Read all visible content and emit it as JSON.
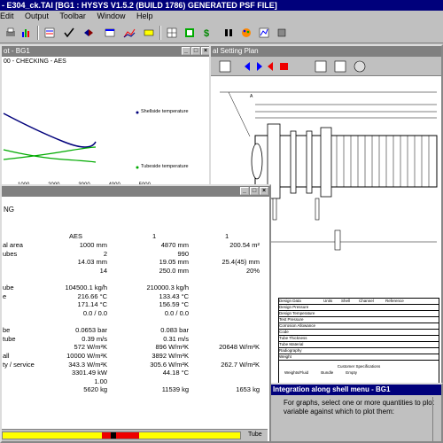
{
  "app": {
    "title": "- E304_ck.TAI [BG1 : HYSYS V1.5.2 (BUILD 1786) GENERATED PSF FILE]",
    "menu": [
      "Edit",
      "Output",
      "Toolbar",
      "Window",
      "Help"
    ],
    "toolbar_icons": [
      "print-icon",
      "bar-chart-icon",
      "data-icon",
      "checkmark-icon",
      "arrows-icon",
      "window-icon",
      "chart-icon",
      "drawing-icon",
      "grid-icon",
      "table-icon",
      "dollar-icon",
      "pause-icon",
      "palette-icon",
      "plot-icon",
      "box-icon"
    ]
  },
  "plot_window": {
    "title": "ot - BG1",
    "subtitle": "00 - CHECKING - AES",
    "legend": [
      "Shellside temperature",
      "Tubeside temperature"
    ],
    "x_ticks": [
      "1000",
      "2000",
      "3000",
      "4000",
      "5000"
    ]
  },
  "setting_plan": {
    "title": "al Setting Plan",
    "dim_label": "A",
    "spec_block": {
      "header": [
        "Design Data",
        "Units",
        "Shell",
        "Channel",
        "Reference"
      ],
      "rows": [
        "Design Pressure",
        "Design Temperature",
        "Test Pressure",
        "Corrosion Allowance",
        "Code",
        "Tube Thickness",
        "Tube Material",
        "Radiography",
        "Weight"
      ]
    },
    "notes": [
      "Customer Specifications",
      "Weights/Fluid",
      "Bundle",
      "Empty"
    ]
  },
  "results_window": {
    "title": "NG",
    "col_headers": [
      "AES",
      "1",
      "1"
    ],
    "rows": [
      {
        "label": "al area",
        "c1": "1000 mm",
        "c2": "4870 mm",
        "c3": "200.54 m²"
      },
      {
        "label": "ubes",
        "c1": "2",
        "c2": "990",
        "c3": ""
      },
      {
        "label": "",
        "c1": "14.03 mm",
        "c2": "19.05 mm",
        "c3": "25.4(45) mm"
      },
      {
        "label": "",
        "c1": "14",
        "c2": "250.0 mm",
        "c3": "20%"
      },
      {
        "label": "",
        "c1": "",
        "c2": "",
        "c3": ""
      },
      {
        "label": "ube",
        "c1": "104500.1 kg/h",
        "c2": "210000.3 kg/h",
        "c3": ""
      },
      {
        "label": "e",
        "c1": "216.66 °C",
        "c2": "133.43 °C",
        "c3": ""
      },
      {
        "label": "",
        "c1": "171.14 °C",
        "c2": "156.59 °C",
        "c3": ""
      },
      {
        "label": "",
        "c1": "0.0 / 0.0",
        "c2": "0.0 / 0.0",
        "c3": ""
      },
      {
        "label": "",
        "c1": "",
        "c2": "",
        "c3": ""
      },
      {
        "label": "be",
        "c1": "0.0653 bar",
        "c2": "0.083 bar",
        "c3": ""
      },
      {
        "label": "tube",
        "c1": "0.39 m/s",
        "c2": "0.31 m/s",
        "c3": ""
      },
      {
        "label": "",
        "c1": "572 W/m²K",
        "c2": "896 W/m²K",
        "c3": "20648 W/m²K"
      },
      {
        "label": "all",
        "c1": "10000 W/m²K",
        "c2": "3892 W/m²K",
        "c3": ""
      },
      {
        "label": "ty / service",
        "c1": "343.3 W/m²K",
        "c2": "305.6 W/m²K",
        "c3": "262.7 W/m²K"
      },
      {
        "label": "",
        "c1": "3301.49 kW",
        "c2": "44.18 °C",
        "c3": ""
      },
      {
        "label": "",
        "c1": "1.00",
        "c2": "",
        "c3": ""
      },
      {
        "label": "",
        "c1": "5620 kg",
        "c2": "11539 kg",
        "c3": "1653 kg"
      }
    ],
    "status_label": "Tube",
    "progress_fraction": 0.9
  },
  "integration_window": {
    "title": "Integration along shell menu - BG1",
    "text": "For graphs, select one or more quantities to plot variable against which to plot them:"
  }
}
